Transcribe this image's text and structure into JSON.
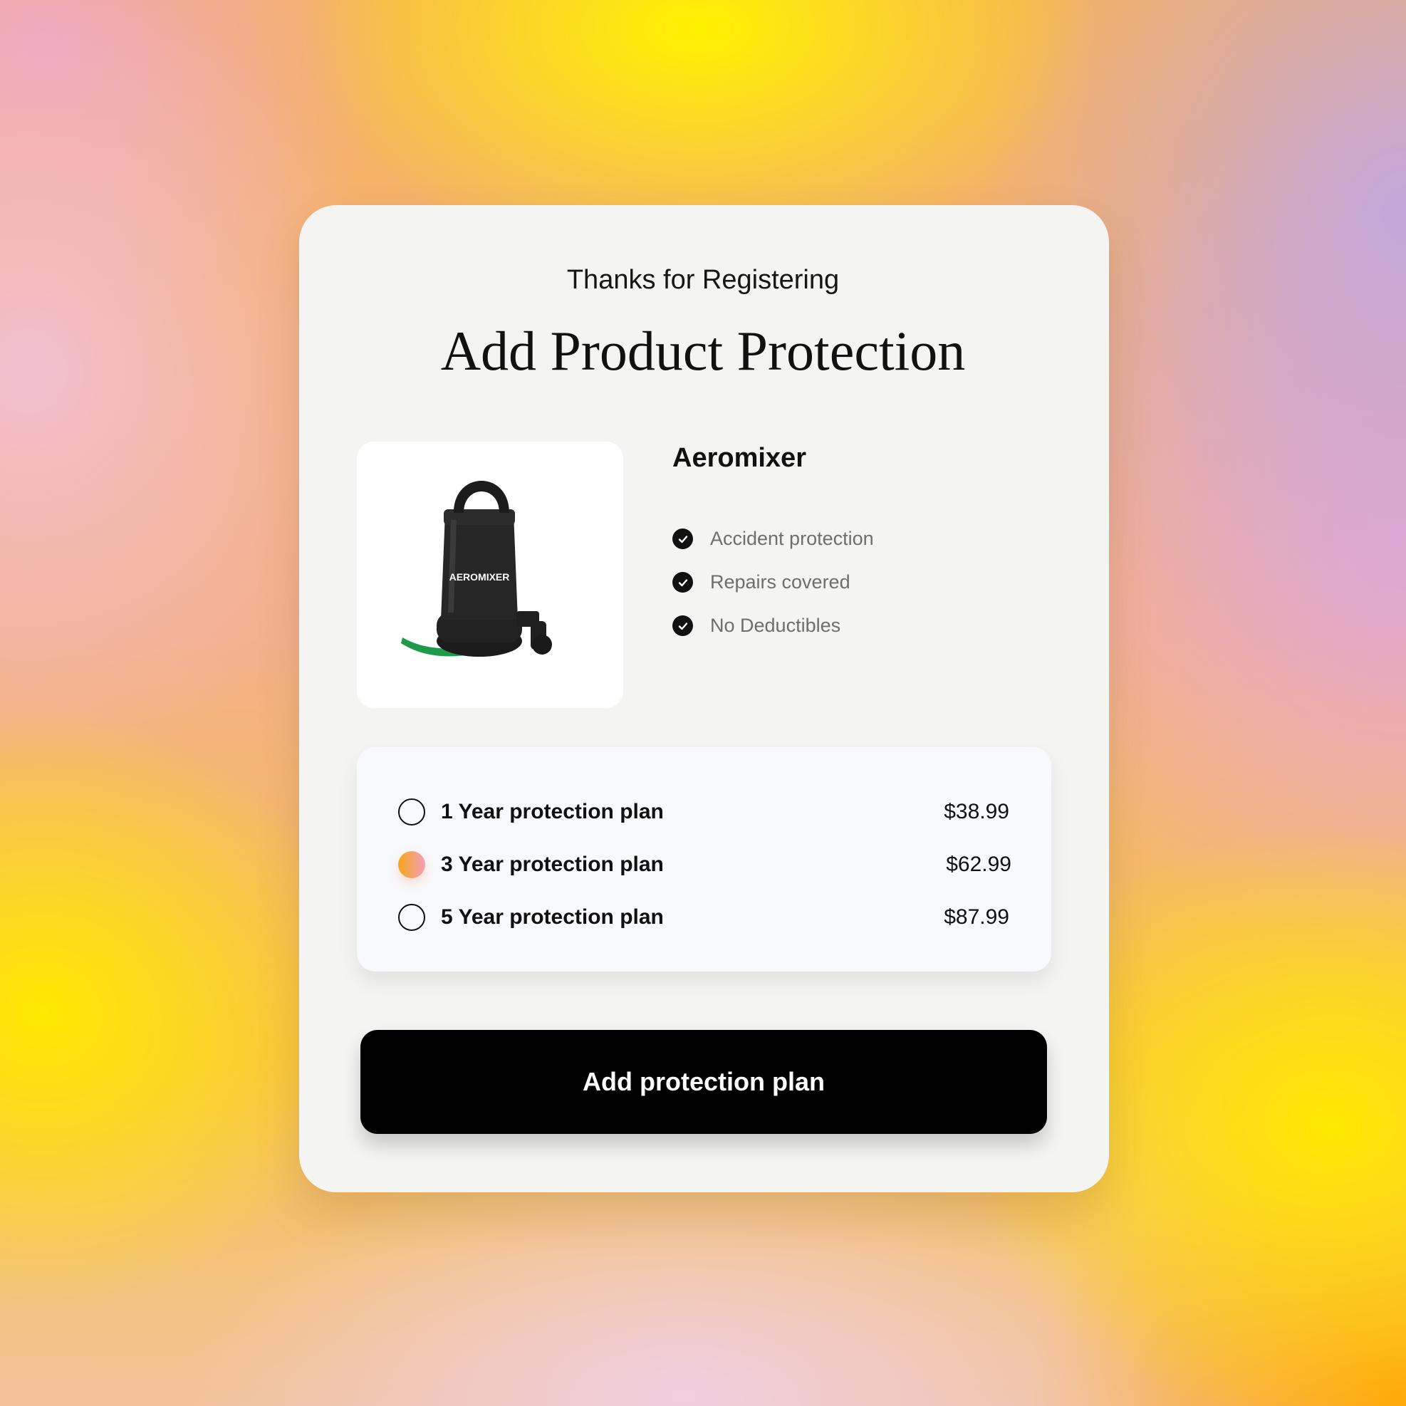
{
  "header": {
    "subtitle": "Thanks for Registering",
    "title": "Add Product Protection"
  },
  "product": {
    "name": "Aeromixer",
    "image_icon": "aeromixer-pump-image",
    "image_brand_text": "AEROMIXER",
    "features": [
      {
        "label": "Accident protection",
        "icon": "check-circle-icon"
      },
      {
        "label": "Repairs covered",
        "icon": "check-circle-icon"
      },
      {
        "label": "No Deductibles",
        "icon": "check-circle-icon"
      }
    ]
  },
  "plans": [
    {
      "label": "1 Year protection plan",
      "price": "$38.99",
      "selected": false
    },
    {
      "label": "3 Year protection plan",
      "price": "$62.99",
      "selected": true
    },
    {
      "label": "5 Year protection plan",
      "price": "$87.99",
      "selected": false
    }
  ],
  "cta": {
    "label": "Add protection plan"
  },
  "colors": {
    "card_bg": "#f4f5f2",
    "button_bg": "#000000",
    "selected_radio_gradient_start": "#f7a51b",
    "selected_radio_gradient_end": "#f4a0b8"
  }
}
